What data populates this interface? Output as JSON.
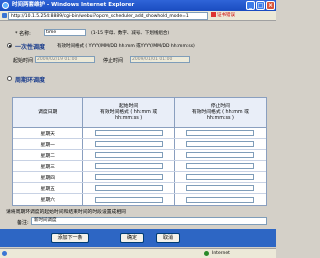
{
  "window": {
    "title": "时间两套维护 - Windows Internet Explorer",
    "address": "http://10.1.5.254:8889/cgi-bin/webui?opcm_scheduler_add_showhold_mode=1",
    "cert_error": "证书错误",
    "status_zone": "Internet",
    "min_label": "_",
    "max_label": "□",
    "close_label": "×"
  },
  "form": {
    "name_label": "* 名称:",
    "name_value": "time",
    "name_hint": "(1-15 字母、数字、减号、下划线组合)",
    "once_section": {
      "title": "一次性调度",
      "format_hint": "有效时间格式 ( YYYY/MM/DD hh:mm 或YYYY/MM/DD hh:mm:ss)",
      "start_label": "起始时间",
      "start_value": "2009/02/19 01:00",
      "stop_label": "停止时间",
      "stop_value": "2009/01/01 01:00"
    },
    "cycle_section": {
      "title": "周期环调度",
      "table": {
        "headers": [
          [
            "调度日期"
          ],
          [
            "起始时间",
            "有效时间格式 ( hh:mm 或",
            "hh:mm:ss )"
          ],
          [
            "停止时间",
            "有效时间格式 ( hh:mm 或",
            "hh:mm:ss )"
          ]
        ],
        "rows": [
          "星期天",
          "星期一",
          "星期二",
          "星期三",
          "星期四",
          "星期五",
          "星期六"
        ]
      }
    },
    "note": "请将周期环调度的起始时间和结束时间的时段设置成相同",
    "remark_label": "备注:",
    "remark_value": "新时间调度"
  },
  "buttons": {
    "add_next": "添加下一条",
    "ok": "确定",
    "cancel": "取消"
  }
}
